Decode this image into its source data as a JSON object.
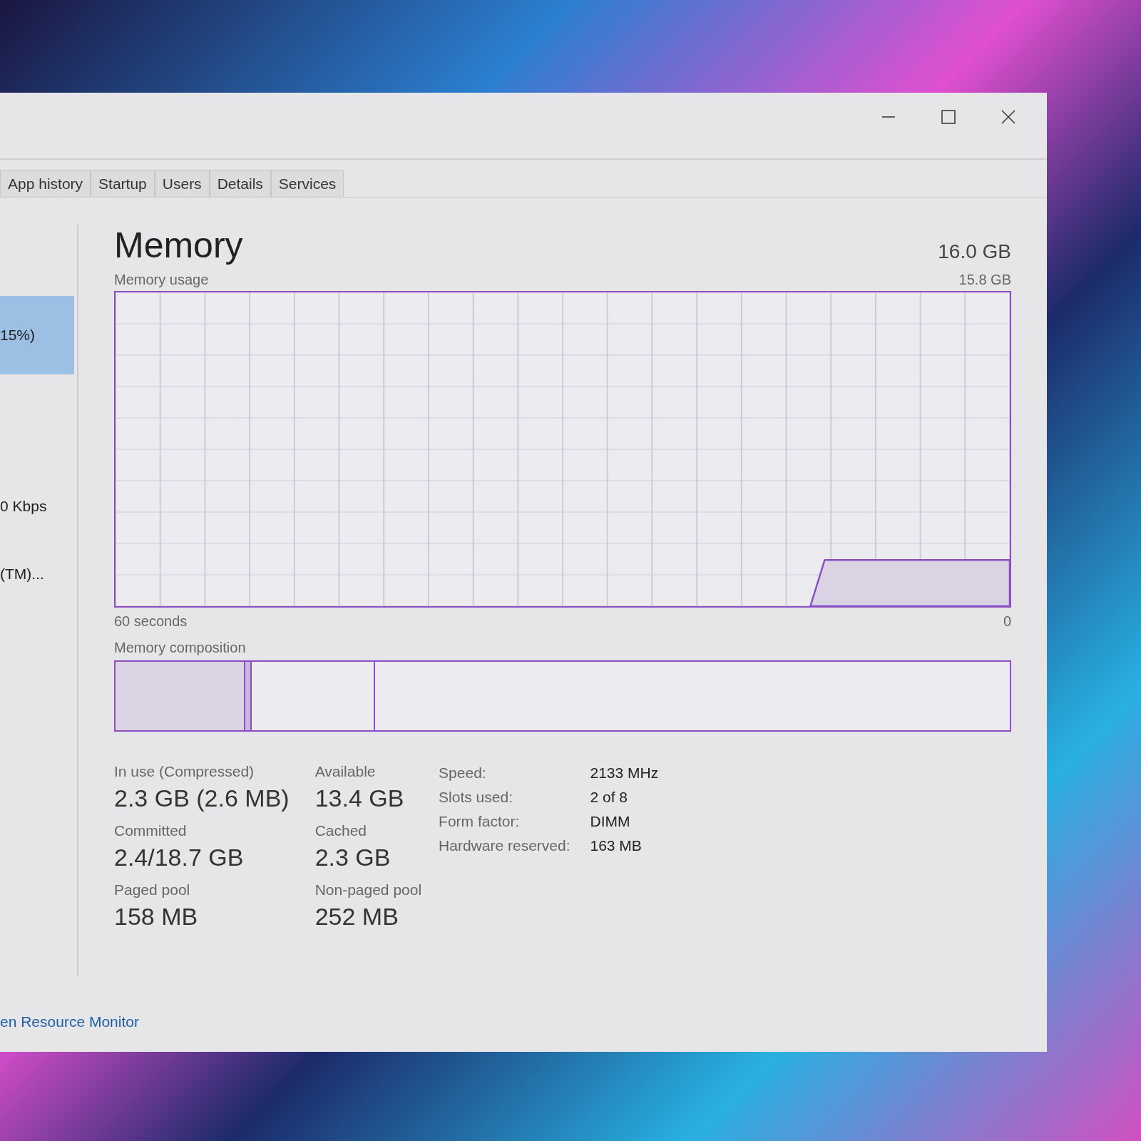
{
  "tabs": [
    {
      "label": "App history",
      "selected": false
    },
    {
      "label": "Startup",
      "selected": false
    },
    {
      "label": "Users",
      "selected": false
    },
    {
      "label": "Details",
      "selected": false
    },
    {
      "label": "Services",
      "selected": false
    }
  ],
  "sidebar": {
    "items": [
      {
        "label": "15%)",
        "selected": true
      },
      {
        "label": "0 Kbps",
        "selected": false
      },
      {
        "label": "(TM)...",
        "selected": false
      }
    ]
  },
  "memory": {
    "title": "Memory",
    "total": "16.0 GB",
    "usage_graph": {
      "label": "Memory usage",
      "max": "15.8 GB",
      "x_start": "60 seconds",
      "x_end": "0"
    },
    "composition": {
      "label": "Memory composition",
      "segments": [
        {
          "kind": "in_use",
          "level": 0.145
        },
        {
          "kind": "modified",
          "level": 0.007
        },
        {
          "kind": "standby",
          "level": 0.138
        },
        {
          "kind": "free",
          "level": 0.71
        }
      ]
    },
    "stats": [
      {
        "label": "In use (Compressed)",
        "value": "2.3 GB (2.6 MB)"
      },
      {
        "label": "Available",
        "value": "13.4 GB"
      },
      {
        "label": "Committed",
        "value": "2.4/18.7 GB"
      },
      {
        "label": "Cached",
        "value": "2.3 GB"
      },
      {
        "label": "Paged pool",
        "value": "158 MB"
      },
      {
        "label": "Non-paged pool",
        "value": "252 MB"
      }
    ],
    "details": [
      {
        "label": "Speed:",
        "value": "2133 MHz"
      },
      {
        "label": "Slots used:",
        "value": "2 of 8"
      },
      {
        "label": "Form factor:",
        "value": "DIMM"
      },
      {
        "label": "Hardware reserved:",
        "value": "163 MB"
      }
    ]
  },
  "footer_link": "en Resource Monitor"
}
